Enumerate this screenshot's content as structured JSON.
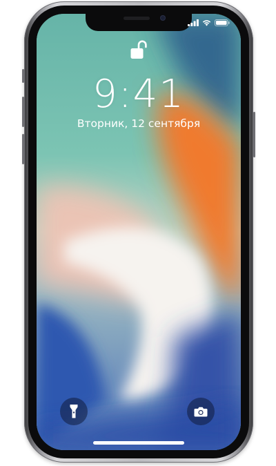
{
  "lockscreen": {
    "time": "9:41",
    "date": "Вторник, 12 сентября"
  },
  "status_bar": {
    "icons": [
      "cellular-signal-icon",
      "wifi-icon",
      "battery-icon"
    ]
  },
  "controls": {
    "left_icon": "flashlight-icon",
    "right_icon": "camera-icon"
  },
  "colors": {
    "wallpaper_green": "#6fb8ad",
    "wallpaper_orange": "#f07a2e",
    "wallpaper_blue": "#3a5fb3",
    "wallpaper_white": "#f6f3ef",
    "frame_silver": "#c9c9cd",
    "bezel": "#0b0b0c"
  }
}
